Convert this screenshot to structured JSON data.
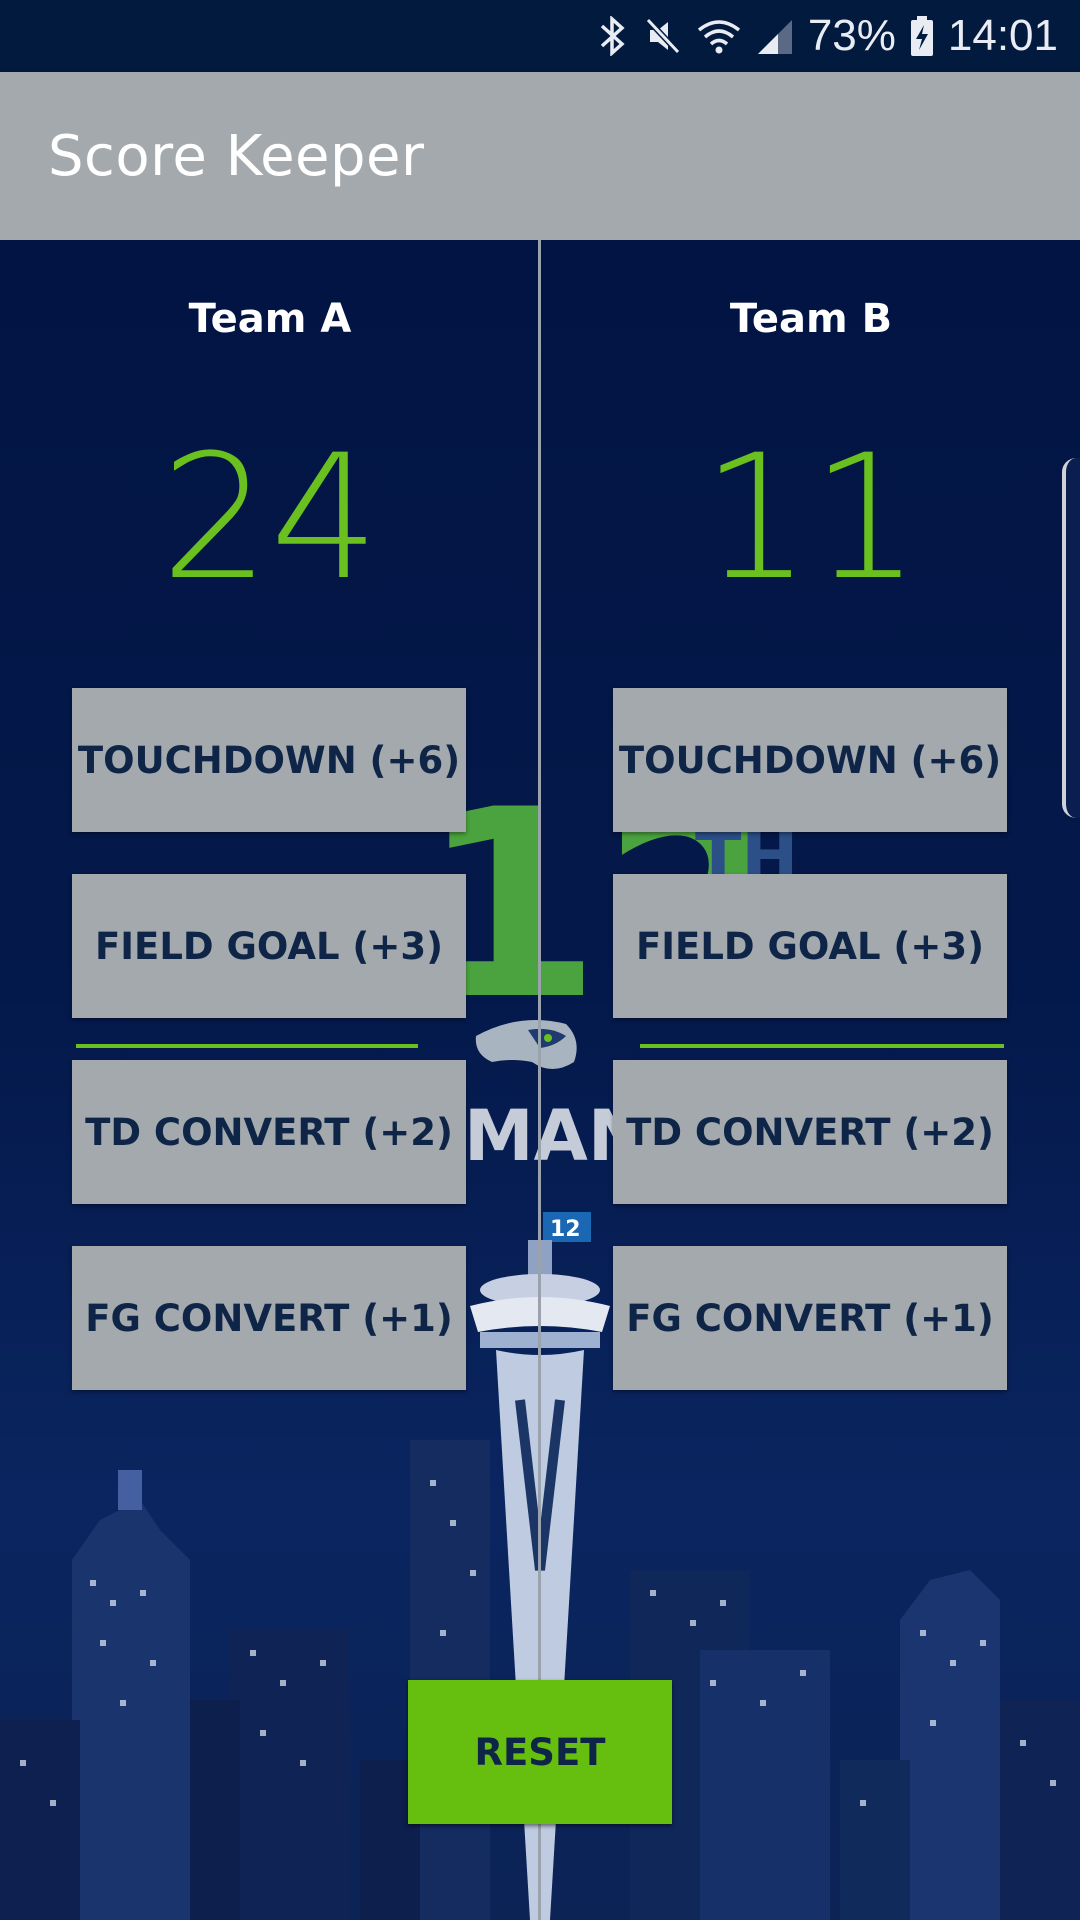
{
  "status_bar": {
    "battery_percent": "73%",
    "time": "14:01",
    "icons": [
      "bluetooth-icon",
      "mute-icon",
      "wifi-icon",
      "signal-icon",
      "battery-charging-icon"
    ]
  },
  "app_bar": {
    "title": "Score Keeper"
  },
  "background": {
    "logo_number": "12",
    "logo_suffix": "TH",
    "logo_word": "MAN",
    "badge_text": "12"
  },
  "team_a": {
    "name": "Team A",
    "score": "24",
    "buttons": {
      "touchdown": "TOUCHDOWN (+6)",
      "field_goal": "FIELD GOAL (+3)",
      "td_convert": "TD CONVERT (+2)",
      "fg_convert": "FG CONVERT (+1)"
    }
  },
  "team_b": {
    "name": "Team B",
    "score": "11",
    "buttons": {
      "touchdown": "TOUCHDOWN (+6)",
      "field_goal": "FIELD GOAL (+3)",
      "td_convert": "TD CONVERT (+2)",
      "fg_convert": "FG CONVERT (+1)"
    }
  },
  "reset_label": "RESET",
  "colors": {
    "score": "#69c01e",
    "button_bg": "#a3a9ad",
    "button_text": "#0f2547",
    "reset_bg": "#66bf0f",
    "background": "#031538"
  }
}
